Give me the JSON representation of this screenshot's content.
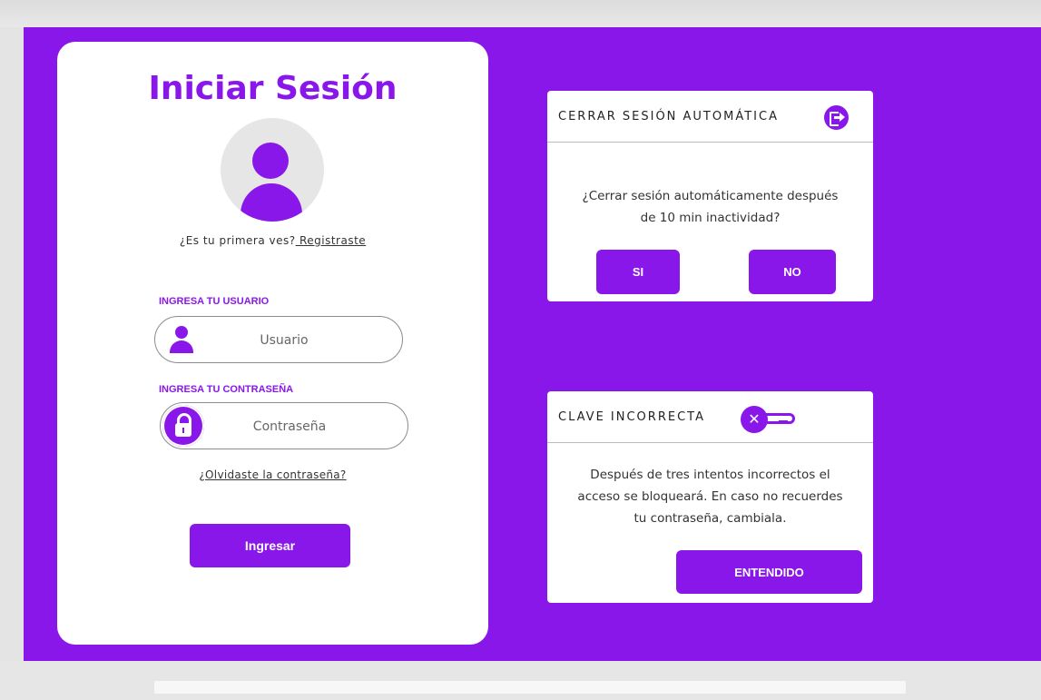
{
  "login": {
    "title": "Iniciar Sesión",
    "first_time_text": "¿Es tu primera ves?",
    "register_link": " Registraste ",
    "user_label": "INGRESA TU USUARIO",
    "user_placeholder": "Usuario",
    "password_label": "INGRESA TU CONTRASEÑA",
    "password_placeholder": "Contraseña",
    "forgot_link": "¿Olvidaste la contraseña?",
    "submit_label": "Ingresar"
  },
  "logout_modal": {
    "title": "CERRAR SESIÓN AUTOMÁTICA",
    "icon": "logout-icon",
    "message_line1": "¿Cerrar sesión automáticamente después",
    "message_line2": "de 10 min inactividad?",
    "yes_label": "SI",
    "no_label": "NO"
  },
  "wrong_key_modal": {
    "title": "CLAVE INCORRECTA",
    "icon": "wrong-key-icon",
    "message_line1": "Después de tres intentos incorrectos el",
    "message_line2": "acceso se bloqueará. En caso no recuerdes",
    "message_line3": "tu contraseña, cambiala.",
    "ok_label": "ENTENDIDO"
  },
  "colors": {
    "brand": "#8a17ea",
    "card": "#ffffff",
    "frame": "#e4e4e4"
  }
}
